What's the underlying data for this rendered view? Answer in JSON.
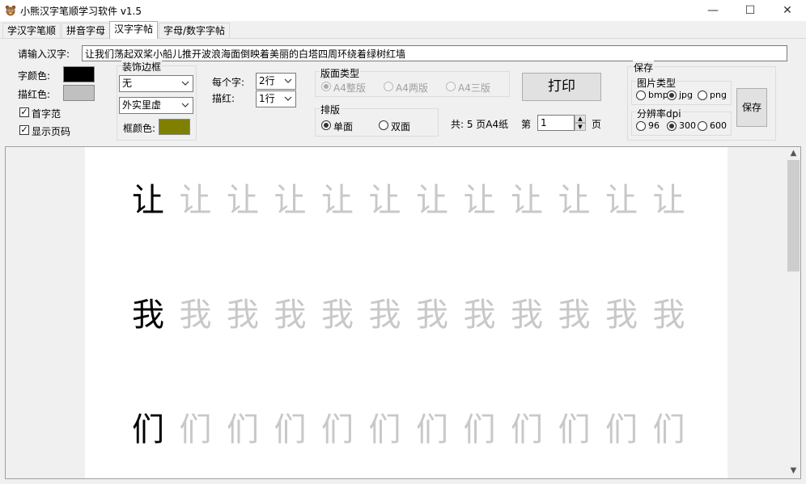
{
  "window": {
    "title": "小熊汉字笔顺学习软件 v1.5",
    "controls": {
      "minimize": "—",
      "maximize": "☐",
      "close": "✕"
    }
  },
  "tabs": [
    {
      "label": "学汉字笔顺",
      "active": false
    },
    {
      "label": "拼音字母",
      "active": false
    },
    {
      "label": "汉字字帖",
      "active": true
    },
    {
      "label": "字母/数字字帖",
      "active": false
    }
  ],
  "input": {
    "label": "请输入汉字:",
    "value": "让我们荡起双桨小船儿推开波浪海面倒映着美丽的白塔四周环绕着绿树红墙"
  },
  "colors": {
    "char_color_label": "字颜色:",
    "char_color": "#000000",
    "trace_color_label": "描红色:",
    "trace_color": "#c0c0c0",
    "frame_color_label": "框颜色:",
    "frame_color": "#808000"
  },
  "checkboxes": {
    "first_sample": {
      "label": "首字范",
      "checked": true
    },
    "show_page_no": {
      "label": "显示页码",
      "checked": true
    }
  },
  "border": {
    "group_title": "装饰边框",
    "style_value": "无",
    "line_value": "外实里虚"
  },
  "per_char": {
    "label": "每个字:",
    "value": "2行"
  },
  "trace": {
    "label": "描红:",
    "value": "1行"
  },
  "layout_type": {
    "group_title": "版面类型",
    "options": [
      {
        "label": "A4整版",
        "selected": true
      },
      {
        "label": "A4两版",
        "selected": false
      },
      {
        "label": "A4三版",
        "selected": false
      }
    ]
  },
  "typeset": {
    "group_title": "排版",
    "options": [
      {
        "label": "单面",
        "selected": true
      },
      {
        "label": "双面",
        "selected": false
      }
    ]
  },
  "print_button": "打印",
  "pages": {
    "total_text": "共: 5 页A4纸",
    "prefix": "第",
    "current": "1",
    "suffix": "页"
  },
  "save": {
    "group_title": "保存",
    "image_type_title": "图片类型",
    "image_types": [
      {
        "label": "bmp",
        "selected": false
      },
      {
        "label": "jpg",
        "selected": true
      },
      {
        "label": "png",
        "selected": false
      }
    ],
    "dpi_title": "分辨率dpi",
    "dpis": [
      {
        "label": "96",
        "selected": false
      },
      {
        "label": "300",
        "selected": true
      },
      {
        "label": "600",
        "selected": false
      }
    ],
    "button": "保存"
  },
  "preview": {
    "rows": [
      {
        "char": "让",
        "trace_count": 11
      },
      {
        "char": "我",
        "trace_count": 11
      },
      {
        "char": "们",
        "trace_count": 11
      }
    ]
  }
}
